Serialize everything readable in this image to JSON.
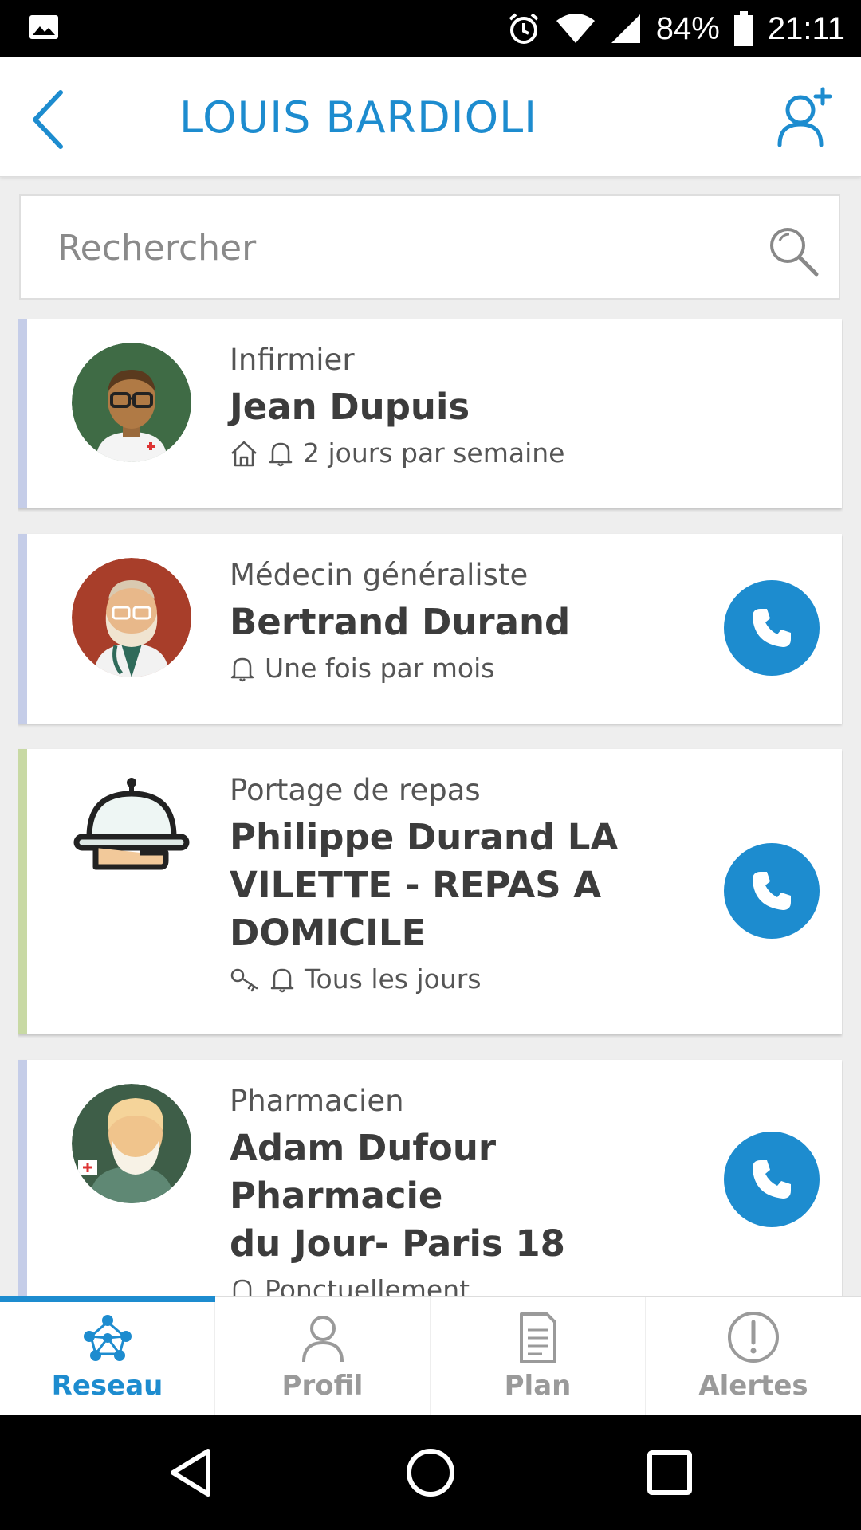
{
  "status_bar": {
    "battery": "84%",
    "time": "21:11",
    "icons": [
      "image-icon",
      "alarm-icon",
      "wifi-icon",
      "signal-icon",
      "battery-icon"
    ]
  },
  "header": {
    "title": "LOUIS BARDIOLI",
    "back_icon": "back-chevron-icon",
    "add_icon": "add-user-icon",
    "accent": "#1d8ccf"
  },
  "search": {
    "placeholder": "Rechercher",
    "value": ""
  },
  "contacts": [
    {
      "role": "Infirmier",
      "name": "Jean Dupuis",
      "frequency": "2 jours par semaine",
      "icons": [
        "home-icon",
        "bell-icon"
      ],
      "stripe_color": "#c5cde8",
      "has_call": false
    },
    {
      "role": "Médecin généraliste",
      "name": "Bertrand Durand",
      "frequency": "Une fois par mois",
      "icons": [
        "bell-icon"
      ],
      "stripe_color": "#c5cde8",
      "has_call": true
    },
    {
      "role": "Portage de repas",
      "name": "Philippe Durand LA VILETTE - REPAS A DOMICILE",
      "name_lines": [
        "Philippe Durand LA",
        "VILETTE - REPAS A",
        "DOMICILE"
      ],
      "frequency": "Tous les jours",
      "icons": [
        "key-icon",
        "bell-icon"
      ],
      "stripe_color": "#c8d9a4",
      "has_call": true
    },
    {
      "role": "Pharmacien",
      "name": "Adam Dufour Pharmacie du Jour- Paris 18",
      "name_lines": [
        "Adam Dufour Pharmacie",
        "du Jour- Paris 18"
      ],
      "frequency": "Ponctuellement",
      "icons": [
        "bell-icon"
      ],
      "stripe_color": "#c5cde8",
      "has_call": true
    }
  ],
  "bottom_nav": {
    "tabs": [
      {
        "label": "Reseau",
        "icon": "network-icon",
        "active": true
      },
      {
        "label": "Profil",
        "icon": "person-icon",
        "active": false
      },
      {
        "label": "Plan",
        "icon": "document-icon",
        "active": false
      },
      {
        "label": "Alertes",
        "icon": "alert-icon",
        "active": false
      }
    ]
  },
  "system_nav": [
    "back-triangle-icon",
    "home-circle-icon",
    "recents-square-icon"
  ]
}
